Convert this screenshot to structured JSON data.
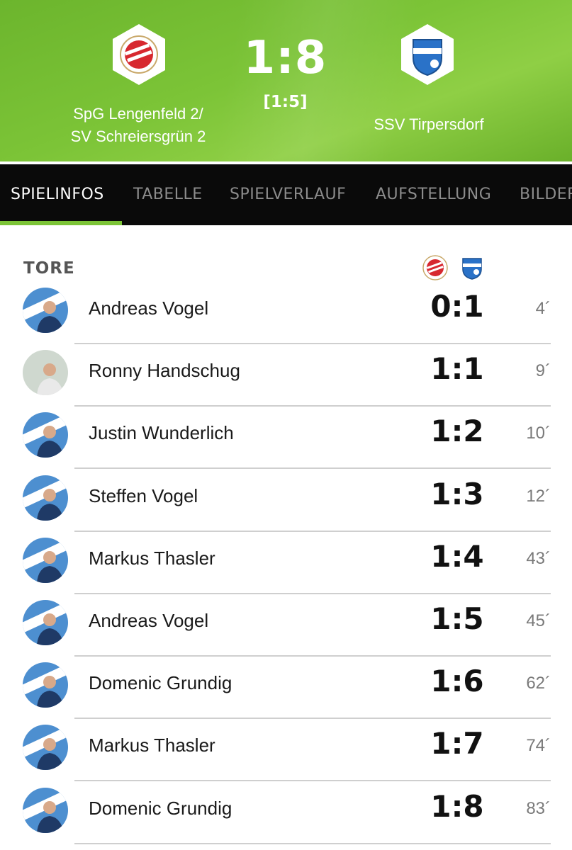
{
  "match": {
    "score": "1:8",
    "halftime": "[1:5]",
    "home_team": [
      "SpG Lengenfeld 2/",
      "SV Schreiersgrün 2"
    ],
    "away_team": "SSV Tirpersdorf"
  },
  "tabs": [
    {
      "label": "SPIELINFOS",
      "active": true
    },
    {
      "label": "TABELLE",
      "active": false
    },
    {
      "label": "SPIELVERLAUF",
      "active": false
    },
    {
      "label": "AUFSTELLUNG",
      "active": false
    },
    {
      "label": "BILDER",
      "active": false
    }
  ],
  "goals_section": {
    "title": "TORE",
    "goals": [
      {
        "player": "Andreas Vogel",
        "score": "0:1",
        "minute": "4´"
      },
      {
        "player": "Ronny Handschug",
        "score": "1:1",
        "minute": "9´"
      },
      {
        "player": "Justin Wunderlich",
        "score": "1:2",
        "minute": "10´"
      },
      {
        "player": "Steffen Vogel",
        "score": "1:3",
        "minute": "12´"
      },
      {
        "player": "Markus Thasler",
        "score": "1:4",
        "minute": "43´"
      },
      {
        "player": "Andreas Vogel",
        "score": "1:5",
        "minute": "45´"
      },
      {
        "player": "Domenic Grundig",
        "score": "1:6",
        "minute": "62´"
      },
      {
        "player": "Markus Thasler",
        "score": "1:7",
        "minute": "74´"
      },
      {
        "player": "Domenic Grundig",
        "score": "1:8",
        "minute": "83´"
      }
    ]
  },
  "colors": {
    "accent_green": "#7cc437",
    "tab_bar": "#0a0a0a",
    "home_red": "#d7282f",
    "away_blue": "#2a72c8"
  }
}
